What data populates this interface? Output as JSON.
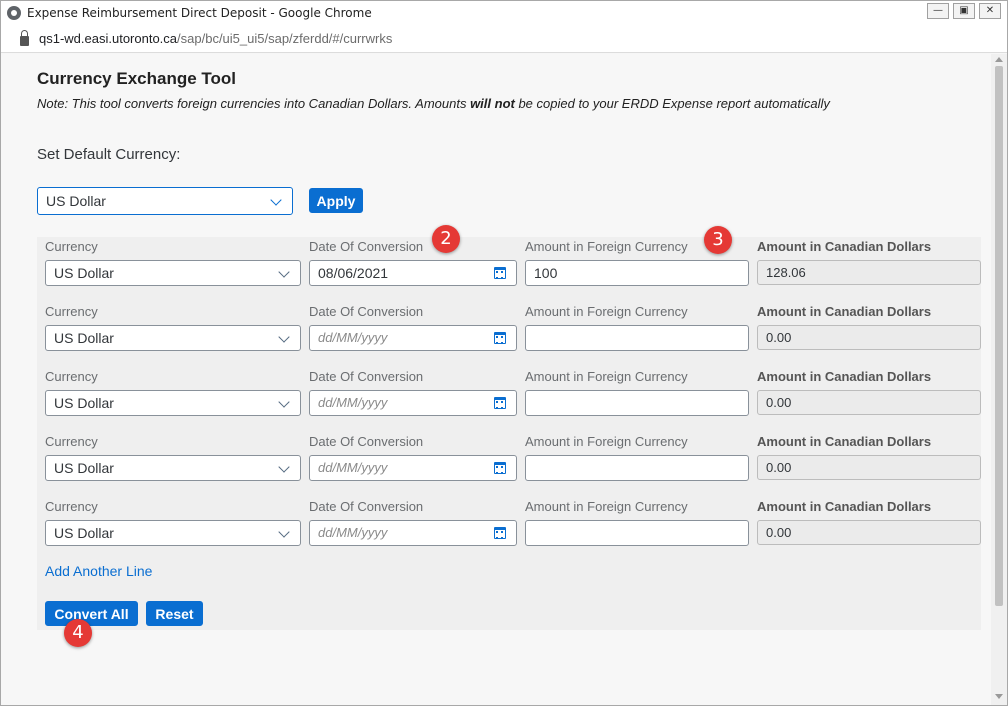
{
  "browser": {
    "window_title": "Expense Reimbursement Direct Deposit - Google Chrome",
    "url_host": "qs1-wd.easi.utoronto.ca",
    "url_path": "/sap/bc/ui5_ui5/sap/zferdd/#/currwrks",
    "controls": {
      "minimize": "—",
      "restore": "▣",
      "close": "✕"
    }
  },
  "page": {
    "title": "Currency Exchange Tool",
    "note_prefix": "Note: This tool converts foreign currencies into Canadian Dollars. Amounts ",
    "note_bold": "will not",
    "note_suffix": " be copied to your ERDD Expense report automatically",
    "default_currency_label": "Set Default Currency:",
    "default_currency_value": "US Dollar",
    "apply_label": "Apply"
  },
  "labels": {
    "currency": "Currency",
    "date": "Date Of Conversion",
    "amount_foreign": "Amount in Foreign Currency",
    "amount_cad": "Amount in Canadian Dollars",
    "date_placeholder": "dd/MM/yyyy"
  },
  "rows": [
    {
      "currency": "US Dollar",
      "date": "08/06/2021",
      "amount": "100",
      "cad": "128.06"
    },
    {
      "currency": "US Dollar",
      "date": "",
      "amount": "",
      "cad": "0.00"
    },
    {
      "currency": "US Dollar",
      "date": "",
      "amount": "",
      "cad": "0.00"
    },
    {
      "currency": "US Dollar",
      "date": "",
      "amount": "",
      "cad": "0.00"
    },
    {
      "currency": "US Dollar",
      "date": "",
      "amount": "",
      "cad": "0.00"
    }
  ],
  "actions": {
    "add_line": "Add Another Line",
    "convert_all": "Convert All",
    "reset": "Reset"
  },
  "annotations": [
    "2",
    "3",
    "4"
  ],
  "colors": {
    "accent": "#0a6ed1",
    "badge": "#e53935"
  }
}
